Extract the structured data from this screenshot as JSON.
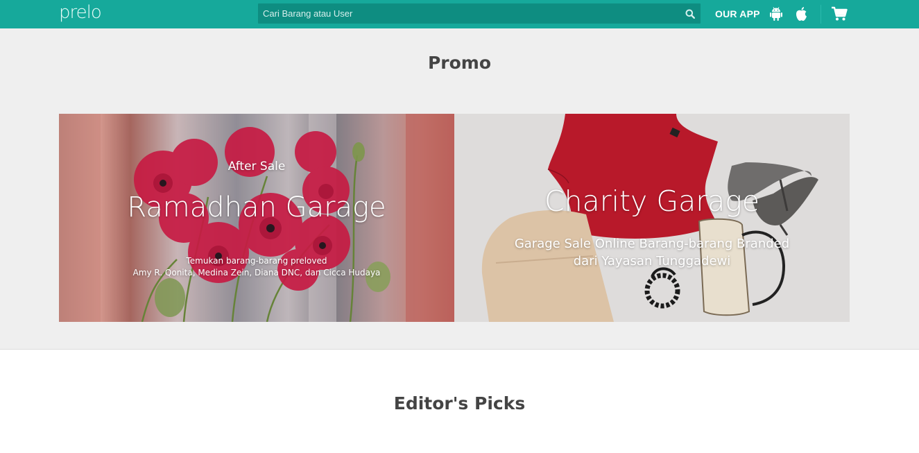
{
  "header": {
    "logo": "prelo",
    "search_placeholder": "Cari Barang atau User",
    "our_app": "OUR APP",
    "icons": [
      "search-icon",
      "android-icon",
      "apple-icon",
      "cart-icon"
    ],
    "bg_color": "#16a99b"
  },
  "promo": {
    "title": "Promo",
    "banners": [
      {
        "subtitle": "After Sale",
        "title": "Ramadhan Garage",
        "desc_line1": "Temukan barang-barang preloved",
        "desc_line2": "Amy R. Qonita, Medina Zein, Diana DNC, dan Cicca Hudaya"
      },
      {
        "title": "Charity Garage",
        "desc_line1": "Garage Sale Online Barang-barang Branded",
        "desc_line2": "dari Yayasan Tunggadewi"
      }
    ]
  },
  "editors_picks": {
    "title": "Editor's Picks"
  }
}
